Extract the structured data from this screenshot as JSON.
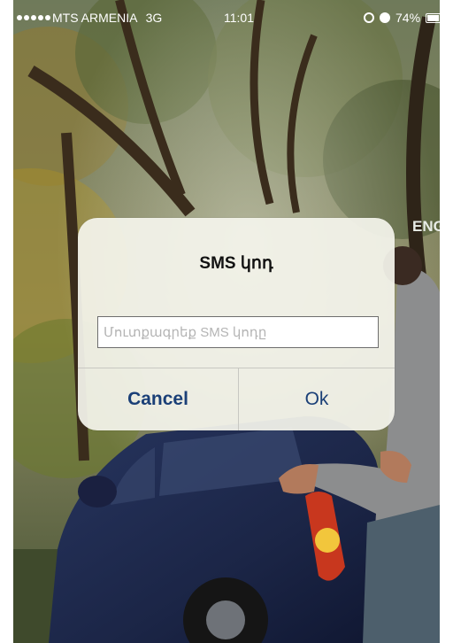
{
  "status_bar": {
    "carrier": "MTS ARMENIA",
    "network": "3G",
    "time": "11:01",
    "battery": "74%",
    "battery_level": 0.74
  },
  "background": {
    "lang_label": "ENG"
  },
  "dialog": {
    "title": "SMS կոդ",
    "input_value": "",
    "input_placeholder": "Մուտքագրեք SMS կոդը",
    "cancel_label": "Cancel",
    "ok_label": "Ok"
  },
  "colors": {
    "dialog_button_text": "#1a3f77",
    "dialog_background": "#f4f4ec"
  }
}
